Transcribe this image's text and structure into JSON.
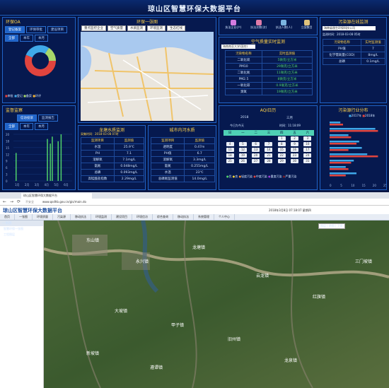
{
  "app": {
    "title": "琼山区智慧环保大数据平台"
  },
  "env_oa": {
    "title": "环保OA",
    "tabs": [
      "登记备案",
      "环保审批",
      "建设项目"
    ],
    "subtabs": [
      "全部",
      "本年",
      "本月"
    ],
    "legend": [
      "审批",
      "登记",
      "备案",
      "环评",
      "其他"
    ]
  },
  "map_top": {
    "title": "环保一张图",
    "buttons": [
      "重点监控企业",
      "空气质量",
      "水质监测",
      "环境监测",
      "生态红线"
    ]
  },
  "quick": {
    "items": [
      "执法企业(户)",
      "执法次数(次)",
      "执法人数(人)",
      "立案数目"
    ],
    "values": [
      "1",
      "1",
      "1",
      "2"
    ]
  },
  "pollution": {
    "title": "污染源在线监测",
    "company": "海南省逸生环保科技公司",
    "time": "监测时间：2018-03-08 05时",
    "headers": [
      "污染物名称",
      "实时监测值"
    ],
    "rows": [
      [
        "PH值",
        "7"
      ],
      [
        "化学需氧量(COD)",
        "8mg/L"
      ],
      [
        "总磷",
        "0.1mg/L"
      ]
    ]
  },
  "air": {
    "title": "空气质量实时监测",
    "station": "海南南亚大学(国控)",
    "headers": [
      "污染物名称",
      "实时监测值"
    ],
    "rows": [
      [
        "二氧化硫",
        "5微克/立方米"
      ],
      [
        "PM10",
        "29微克/立方米"
      ],
      [
        "二氧化氮",
        "11微克/立方米"
      ],
      [
        "PM2.5",
        "8微克/立方米"
      ],
      [
        "一氧化碳",
        "0.9毫克/立方米"
      ],
      [
        "臭氧",
        "19微克/立方米"
      ]
    ]
  },
  "supervision": {
    "title": "监督监察",
    "tabs": [
      "信访投诉",
      "监测报告"
    ],
    "subtabs": [
      "全部",
      "本年",
      "本月"
    ],
    "xlabels": [
      "1月",
      "2月",
      "3月",
      "4月",
      "5月",
      "6月"
    ],
    "ylabels": [
      "20",
      "18",
      "15",
      "12",
      "9",
      "6",
      "3",
      "0"
    ],
    "bars": [
      {
        "x": 1,
        "v": 12
      },
      {
        "x": 4.2,
        "v": 18
      },
      {
        "x": 4.5,
        "v": 16
      },
      {
        "x": 4.7,
        "v": 19
      },
      {
        "x": 5.3,
        "v": 17
      },
      {
        "x": 5.6,
        "v": 20
      }
    ]
  },
  "longtang": {
    "title": "龙塘水质监测",
    "time": "采集时间：2018-03-08 07时",
    "headers": [
      "监测项目",
      "监测值"
    ],
    "rows": [
      [
        "水温",
        "25.9℃"
      ],
      [
        "PH",
        "7.1"
      ],
      [
        "溶解氧",
        "7.1mg/L"
      ],
      [
        "氨氮",
        "0.048mg/L"
      ],
      [
        "总磷",
        "0.093mg/L"
      ],
      [
        "高锰酸盐指数",
        "2.29mg/L"
      ]
    ]
  },
  "river": {
    "title": "城市内河水质",
    "headers": [
      "监测项目",
      "监测值"
    ],
    "rows": [
      [
        "透明度",
        "0.47m"
      ],
      [
        "PH值",
        "6.7"
      ],
      [
        "溶解氧",
        "3.3mg/L"
      ],
      [
        "氨氮",
        "0.255mg/L"
      ],
      [
        "水温",
        "23℃"
      ],
      [
        "总磷氮监测值",
        "14.0mg/L"
      ]
    ]
  },
  "aqi": {
    "title": "AQI日历",
    "year": "2018",
    "month": "三月",
    "date": "今日为今天",
    "time": "时间：11:18:09",
    "weekdays": [
      "日",
      "一",
      "二",
      "三",
      "四",
      "五",
      "六"
    ],
    "days": [
      [
        "",
        "",
        "",
        "",
        "1",
        "2",
        "3"
      ],
      [
        "4",
        "5",
        "6",
        "7",
        "8",
        "9",
        "10"
      ],
      [
        "11",
        "12",
        "13",
        "14",
        "15",
        "16",
        "17"
      ],
      [
        "18",
        "19",
        "20",
        "21",
        "22",
        "23",
        "24"
      ],
      [
        "25",
        "26",
        "27",
        "28",
        "29",
        "30",
        "31"
      ]
    ],
    "legend": [
      "优",
      "良",
      "轻度污染",
      "中度污染",
      "重度污染",
      "严重污染"
    ]
  },
  "industry": {
    "title": "污染源行业分布",
    "legend": [
      "2017年",
      "2018年"
    ],
    "series2017": [
      0.2,
      0.85,
      0.35,
      0.55,
      0.6,
      0.7,
      0.45,
      0.3,
      0.5
    ],
    "series2018": [
      0.25,
      0.9,
      0.4,
      0.5,
      0.35,
      0.9,
      0.4,
      0.35,
      0.3
    ],
    "xlabels": [
      "0",
      "5",
      "10",
      "15",
      "20",
      "25"
    ]
  },
  "browser": {
    "tab": "琼山区智慧环保大数据平台",
    "url": "www.qsdhb.gov.cn/gis/main.do",
    "secure": "不安全"
  },
  "app2": {
    "title": "琼山区智慧环保大数据平台",
    "user": "2018年3月8日 07:18:07 星期四",
    "menu": [
      "首页",
      "一张图",
      "环境质量",
      "污染源",
      "移动执法",
      "环境监测",
      "建设项目",
      "环境信访",
      "综合查询",
      "移动执法",
      "系统管理",
      "个人中心"
    ],
    "tree_title": "一张图",
    "tree": [
      "智慧环保一张图",
      "工程图层"
    ],
    "map_buttons": [
      "图层",
      "地图",
      "卫星"
    ]
  },
  "places": [
    "东山镇",
    "永兴镇",
    "龙塘镇",
    "云龙镇",
    "红旗镇",
    "三门坡镇",
    "大坡镇",
    "甲子镇",
    "旧州镇",
    "龙泉镇",
    "新坡镇",
    "遵谭镇"
  ]
}
